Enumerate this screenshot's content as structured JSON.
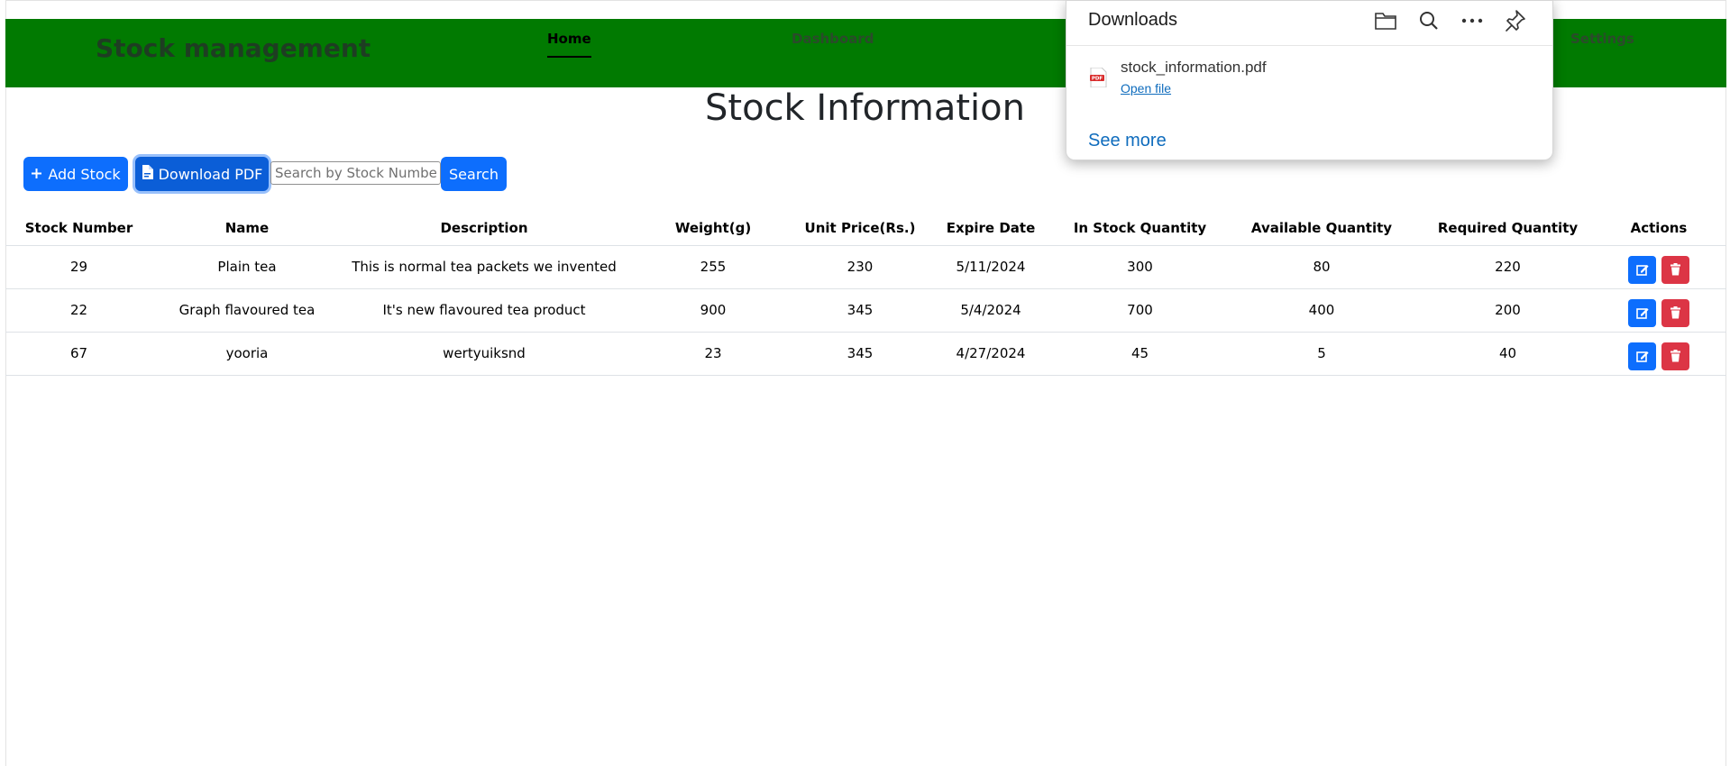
{
  "navbar": {
    "brand": "Stock management",
    "items": [
      {
        "label": "Home",
        "active": true
      },
      {
        "label": "Dashboard",
        "active": false
      },
      {
        "label": "Settings",
        "active": false
      }
    ]
  },
  "page": {
    "title": "Stock Information"
  },
  "toolbar": {
    "add_label": "Add Stock",
    "pdf_label": "Download PDF",
    "search_placeholder": "Search by Stock Number or Name",
    "search_label": "Search"
  },
  "table": {
    "headers": [
      "Stock Number",
      "Name",
      "Description",
      "Weight(g)",
      "Unit Price(Rs.)",
      "Expire Date",
      "In Stock Quantity",
      "Available Quantity",
      "Required Quantity",
      "Actions"
    ],
    "rows": [
      {
        "number": "29",
        "name": "Plain tea",
        "description": "This is normal tea packets we invented",
        "weight": "255",
        "price": "230",
        "expire": "5/11/2024",
        "in_stock": "300",
        "available": "80",
        "required": "220"
      },
      {
        "number": "22",
        "name": "Graph flavoured tea",
        "description": "It's new flavoured tea product",
        "weight": "900",
        "price": "345",
        "expire": "5/4/2024",
        "in_stock": "700",
        "available": "400",
        "required": "200"
      },
      {
        "number": "67",
        "name": "yooria",
        "description": "wertyuiksnd",
        "weight": "23",
        "price": "345",
        "expire": "4/27/2024",
        "in_stock": "45",
        "available": "5",
        "required": "40"
      }
    ]
  },
  "downloads": {
    "title": "Downloads",
    "file_name": "stock_information.pdf",
    "file_action": "Open file",
    "see_more": "See more",
    "file_badge": "PDF"
  },
  "colors": {
    "navbar": "#017A01",
    "primary": "#0d6efd",
    "danger": "#dc3545",
    "link": "#0f6cbd"
  }
}
